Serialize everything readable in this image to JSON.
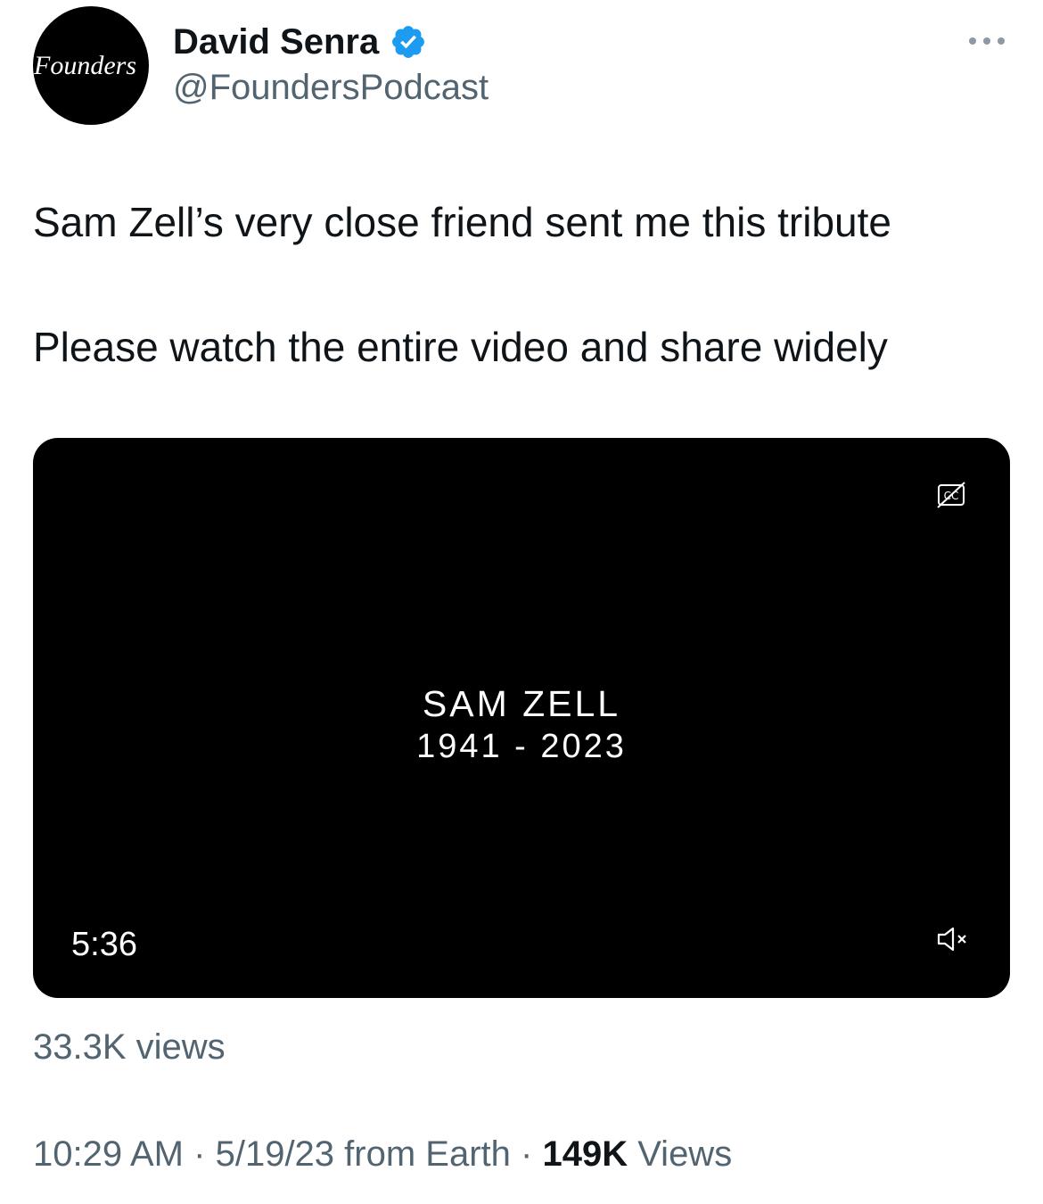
{
  "tweet": {
    "author": {
      "avatar_text": "Founders",
      "display_name": "David Senra",
      "handle": "@FoundersPodcast",
      "verified_icon": "verified-badge-icon"
    },
    "more_icon": "more-options-icon",
    "text_lines": [
      "Sam Zell’s very close friend sent me this tribute",
      "Please watch the entire video and share widely"
    ],
    "video": {
      "title": "SAM ZELL",
      "years": "1941 - 2023",
      "duration": "5:36",
      "captions_icon": "closed-captions-off-icon",
      "mute_icon": "muted-speaker-icon"
    },
    "video_views": "33.3K views",
    "meta": {
      "time": "10:29 AM",
      "separator": "·",
      "date_source": "5/19/23 from Earth",
      "views_count": "149K",
      "views_label": "Views"
    }
  },
  "colors": {
    "text_primary": "#0f1419",
    "text_secondary": "#536471",
    "verified_blue": "#1d9bf0",
    "video_bg": "#000000"
  }
}
